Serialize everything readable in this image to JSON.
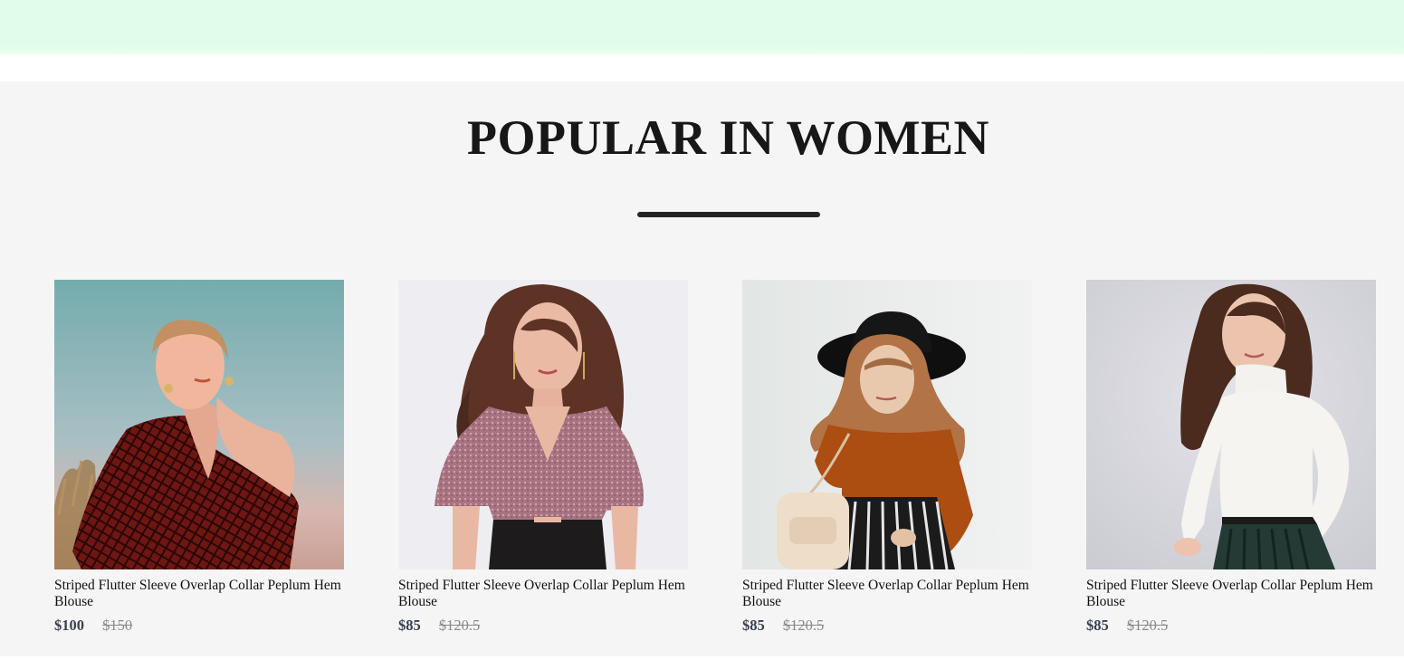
{
  "section": {
    "title": "POPULAR IN WOMEN"
  },
  "products": [
    {
      "name": "Striped Flutter Sleeve Overlap Collar Peplum Hem Blouse",
      "new_price": "$100",
      "old_price": "$150",
      "image_icon": "product-photo-red-checked-top"
    },
    {
      "name": "Striped Flutter Sleeve Overlap Collar Peplum Hem Blouse",
      "new_price": "$85",
      "old_price": "$120.5",
      "image_icon": "product-photo-mauve-crop-top"
    },
    {
      "name": "Striped Flutter Sleeve Overlap Collar Peplum Hem Blouse",
      "new_price": "$85",
      "old_price": "$120.5",
      "image_icon": "product-photo-hijab-hat"
    },
    {
      "name": "Striped Flutter Sleeve Overlap Collar Peplum Hem Blouse",
      "new_price": "$85",
      "old_price": "$120.5",
      "image_icon": "product-photo-white-turtleneck"
    }
  ],
  "colors": {
    "banner": "#e1fde9",
    "section_background": "#f5f5f5",
    "title": "#171717",
    "new_price": "#374151",
    "old_price": "#8a8a8a"
  }
}
